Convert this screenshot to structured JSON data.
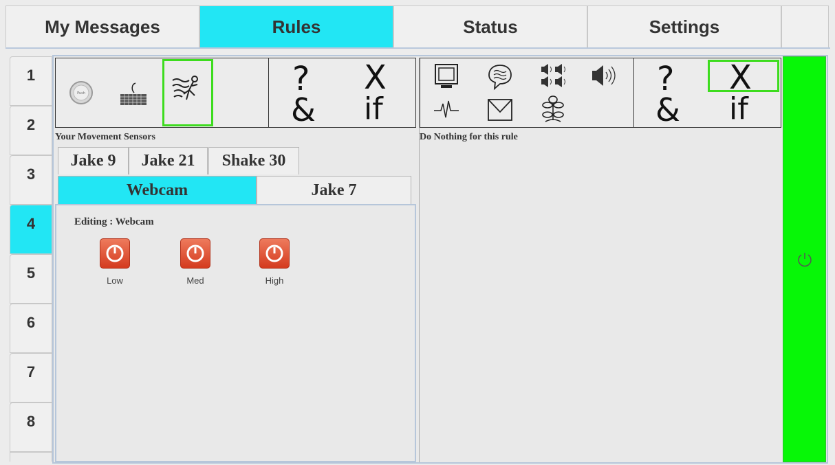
{
  "top_tabs": [
    {
      "label": "My Messages",
      "active": false
    },
    {
      "label": "Rules",
      "active": true
    },
    {
      "label": "Status",
      "active": false
    },
    {
      "label": "Settings",
      "active": false
    }
  ],
  "side_tabs": [
    "1",
    "2",
    "3",
    "4",
    "5",
    "6",
    "7",
    "8"
  ],
  "active_side_tab": "4",
  "left_panel": {
    "caption": "Your Movement Sensors",
    "icons": [
      "push-button-icon",
      "keyboard-icon",
      "movement-sensor-icon"
    ],
    "logic": {
      "question": "?",
      "ampersand": "&",
      "not": "X",
      "if": "if"
    },
    "sensor_tabs_row1": [
      "Jake 9",
      "Jake 21",
      "Shake 30"
    ],
    "sensor_tabs_row2": [
      "Webcam",
      "Jake 7"
    ],
    "active_sensor_tab": "Webcam",
    "editing_label": "Editing : Webcam",
    "buttons": [
      {
        "label": "Low"
      },
      {
        "label": "Med"
      },
      {
        "label": "High"
      }
    ]
  },
  "right_panel": {
    "caption": "Do Nothing for this rule",
    "icons": [
      "monitor-icon",
      "speech-bubble-icon",
      "speakers-icon",
      "volume-icon",
      "pulse-icon",
      "envelope-icon",
      "plant-icon"
    ],
    "logic": {
      "question": "?",
      "ampersand": "&",
      "not": "X",
      "if": "if"
    }
  },
  "colors": {
    "accent": "#22e6f4",
    "selection": "#3ddc1e",
    "power": "#07f707",
    "button": "#e0492b"
  }
}
